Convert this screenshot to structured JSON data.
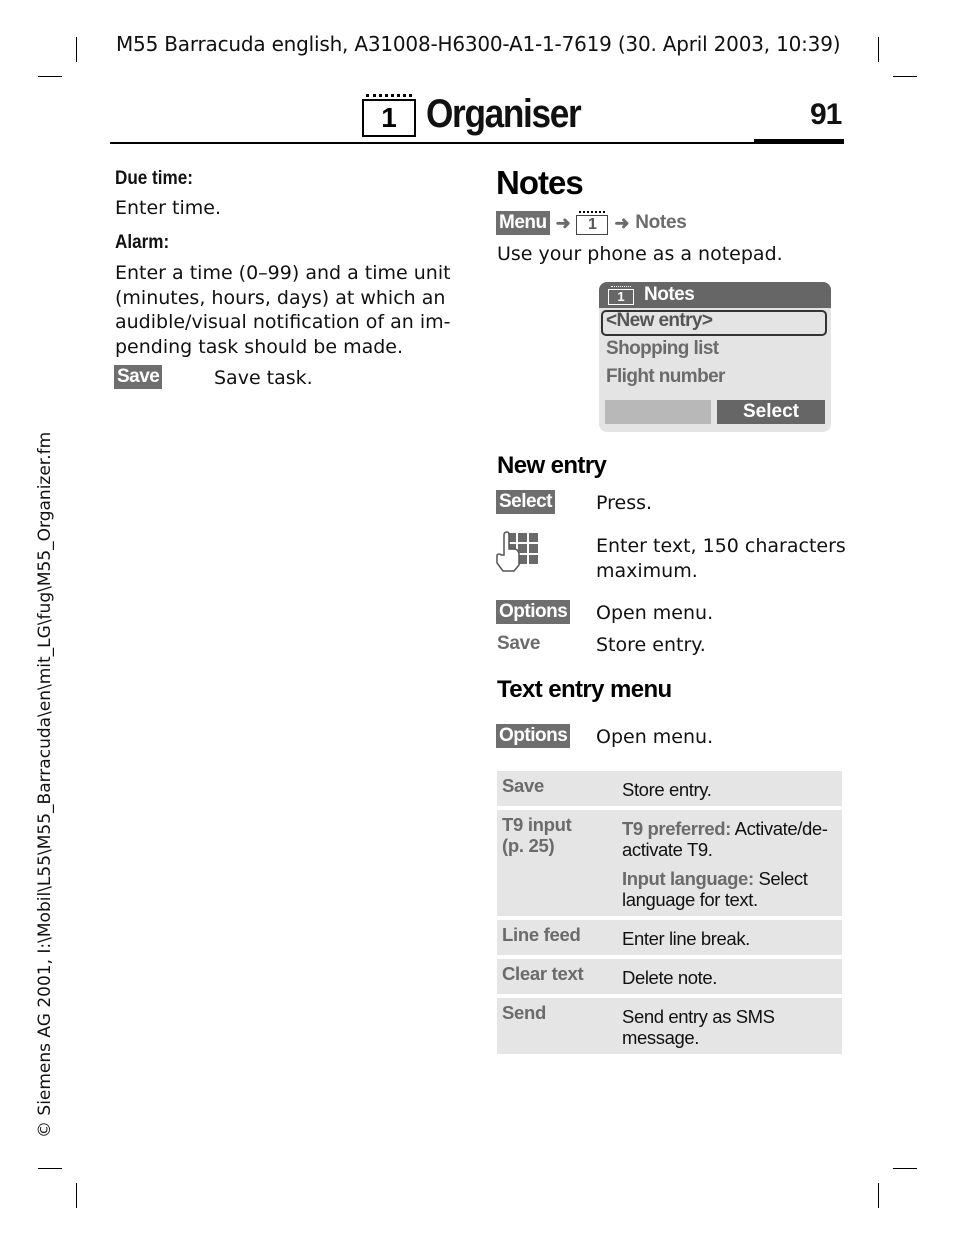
{
  "header": {
    "doc_info": "M55 Barracuda english, A31008-H6300-A1-1-7619 (30. April 2003, 10:39)",
    "chapter_icon": "calendar-icon",
    "chapter_icon_number": "1",
    "chapter_title": "Organiser",
    "page_number": "91"
  },
  "side_note": "© Siemens AG 2001, I:\\Mobil\\L55\\M55_Barracuda\\en\\mit_LG\\fug\\M55_Organizer.fm",
  "left_column": {
    "due_time_label": "Due time:",
    "due_time_text": "Enter time.",
    "alarm_label": "Alarm:",
    "alarm_text_lines": [
      "Enter a time (0–99) and a time unit",
      "(minutes, hours, days) at which an",
      "audible/visual notification of an im-",
      "pending task should be made."
    ],
    "save_key": "Save",
    "save_text": "Save task."
  },
  "notes": {
    "heading": "Notes",
    "breadcrumb": {
      "menu_key": "Menu",
      "arrow": "➜",
      "icon_number": "1",
      "target": "Notes"
    },
    "intro": "Use your phone as a notepad.",
    "phone_screen": {
      "title_icon_number": "1",
      "title": "Notes",
      "items": [
        "<New entry>",
        "Shopping list",
        "Flight number"
      ],
      "selected_index": 0,
      "softkey_left": "",
      "softkey_right": "Select"
    }
  },
  "new_entry": {
    "heading": "New entry",
    "rows": [
      {
        "key": "Select",
        "key_style": "softkey",
        "text": "Press."
      },
      {
        "key_icon": "keypad-hand-icon",
        "text_lines": [
          "Enter text, 150 characters",
          "maximum."
        ]
      },
      {
        "key": "Options",
        "key_style": "softkey",
        "text": "Open menu."
      },
      {
        "key": "Save",
        "key_style": "menu-item",
        "text": "Store entry."
      }
    ]
  },
  "text_entry_menu": {
    "heading": "Text entry menu",
    "options_key": "Options",
    "options_text": "Open menu.",
    "table": [
      {
        "option": "Save",
        "description": "Store entry."
      },
      {
        "option_lines": [
          "T9 input",
          "(p. 25)"
        ],
        "sub_entries": [
          {
            "label": "T9 preferred:",
            "text_lines": [
              " Activate/de-",
              "activate T9."
            ]
          },
          {
            "label": "Input language:",
            "text_lines": [
              " Select",
              "language for text."
            ]
          }
        ]
      },
      {
        "option": "Line feed",
        "description": "Enter line break."
      },
      {
        "option": "Clear text",
        "description": "Delete note."
      },
      {
        "option": "Send",
        "description_lines": [
          "Send entry as SMS",
          "message."
        ]
      }
    ]
  }
}
